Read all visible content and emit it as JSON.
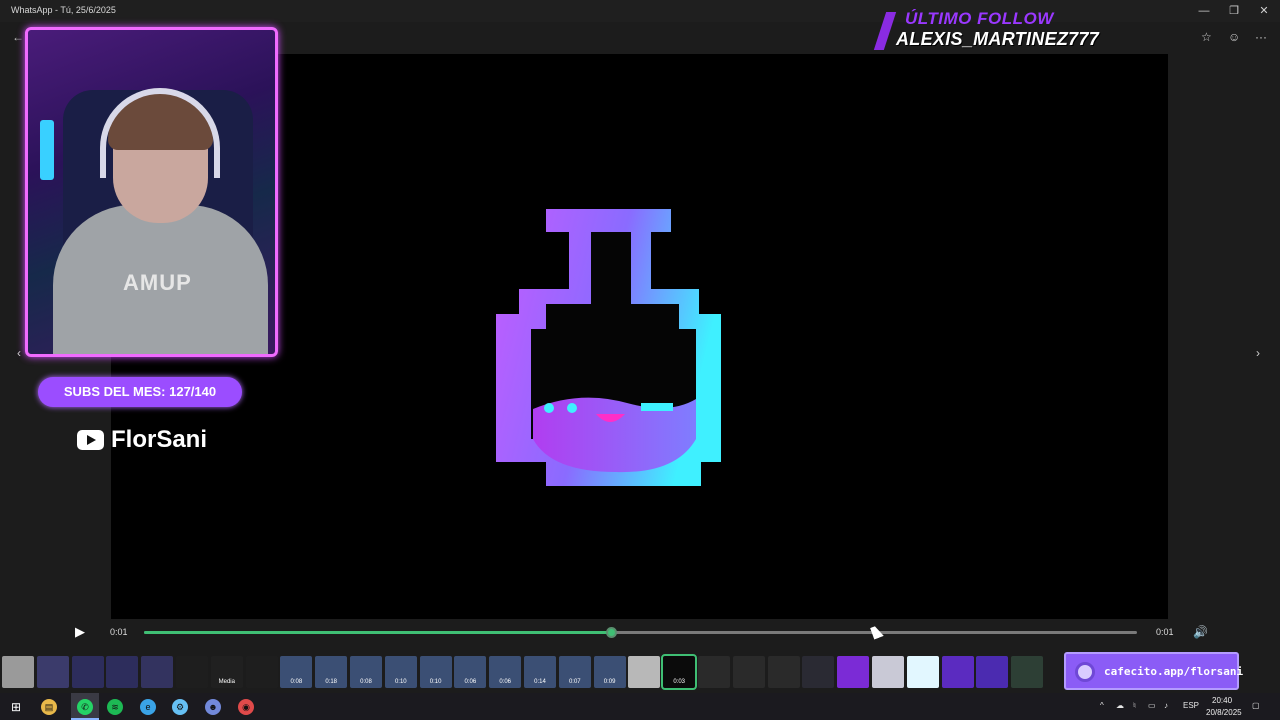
{
  "window": {
    "title": "WhatsApp - Tú, 25/6/2025",
    "minimize": "—",
    "restore": "❐",
    "close": "✕"
  },
  "header": {
    "back": "←",
    "star": "☆",
    "emoji": "☺",
    "more": "···"
  },
  "overlay": {
    "follow_label": "ÚLTIMO FOLLOW",
    "follow_name": "ALEXIS_MARTINEZ777",
    "subs_text": "SUBS DEL MES:  127/140",
    "channel_name": "FlorSani",
    "hoodie_text": "AMUP",
    "cafecito": "cafecito.app/florsani",
    "colors": {
      "accent": "#9b4dff",
      "webcam_border": "#f06bff",
      "follow_purple": "#9a38ff"
    }
  },
  "nav": {
    "prev": "‹",
    "next": "›"
  },
  "player": {
    "play": "▶",
    "current_time": "0:01",
    "total_time": "0:01",
    "progress": 0.47,
    "volume": "🔊",
    "progress_color": "#3fbf74"
  },
  "thumbnails": [
    {
      "label": "",
      "bg": "#9a9a9a"
    },
    {
      "label": "",
      "bg": "#3b3b6b"
    },
    {
      "label": "",
      "bg": "#2d2d5c"
    },
    {
      "label": "",
      "bg": "#2d2d5c"
    },
    {
      "label": "",
      "bg": "#33335f"
    },
    {
      "label": "",
      "bg": "#1e1e1e"
    },
    {
      "label": "Media",
      "bg": "#202020"
    },
    {
      "label": "",
      "bg": "#1e1e1e"
    },
    {
      "label": "0:08",
      "bg": "#3b4f74"
    },
    {
      "label": "0:18",
      "bg": "#3b4f74"
    },
    {
      "label": "0:08",
      "bg": "#3b4f74"
    },
    {
      "label": "0:10",
      "bg": "#3b4f74"
    },
    {
      "label": "0:10",
      "bg": "#3b4f74"
    },
    {
      "label": "0:06",
      "bg": "#3b4f74"
    },
    {
      "label": "0:06",
      "bg": "#3b4f74"
    },
    {
      "label": "0:14",
      "bg": "#3b4f74"
    },
    {
      "label": "0:07",
      "bg": "#3b4f74"
    },
    {
      "label": "0:09",
      "bg": "#3b4f74"
    },
    {
      "label": "",
      "bg": "#b8b8b8"
    },
    {
      "label": "0:03",
      "bg": "#0b0b0b",
      "selected": true
    },
    {
      "label": "",
      "bg": "#2a2a2a"
    },
    {
      "label": "",
      "bg": "#2a2a2a"
    },
    {
      "label": "",
      "bg": "#2a2a2a"
    },
    {
      "label": "",
      "bg": "#2a2a33"
    },
    {
      "label": "",
      "bg": "#7b2bd6"
    },
    {
      "label": "",
      "bg": "#c9c9d6"
    },
    {
      "label": "",
      "bg": "#e2f7ff"
    },
    {
      "label": "",
      "bg": "#5b2bc0"
    },
    {
      "label": "",
      "bg": "#4b2bb0"
    },
    {
      "label": "",
      "bg": "#2d3f35"
    }
  ],
  "taskbar": {
    "start": "⊞",
    "apps": [
      {
        "name": "file-explorer",
        "glyph": "▤",
        "color": "#e8b84a"
      },
      {
        "name": "whatsapp",
        "glyph": "✆",
        "color": "#25d366"
      },
      {
        "name": "spotify",
        "glyph": "≋",
        "color": "#1db954"
      },
      {
        "name": "edge",
        "glyph": "e",
        "color": "#3aa3e6"
      },
      {
        "name": "steam",
        "glyph": "⚙",
        "color": "#66c0f4"
      },
      {
        "name": "discord",
        "glyph": "☻",
        "color": "#7289da"
      },
      {
        "name": "obs",
        "glyph": "◉",
        "color": "#e04a4a"
      }
    ],
    "tray_lang": "ESP",
    "time": "20:40",
    "date": "20/8/2025"
  }
}
